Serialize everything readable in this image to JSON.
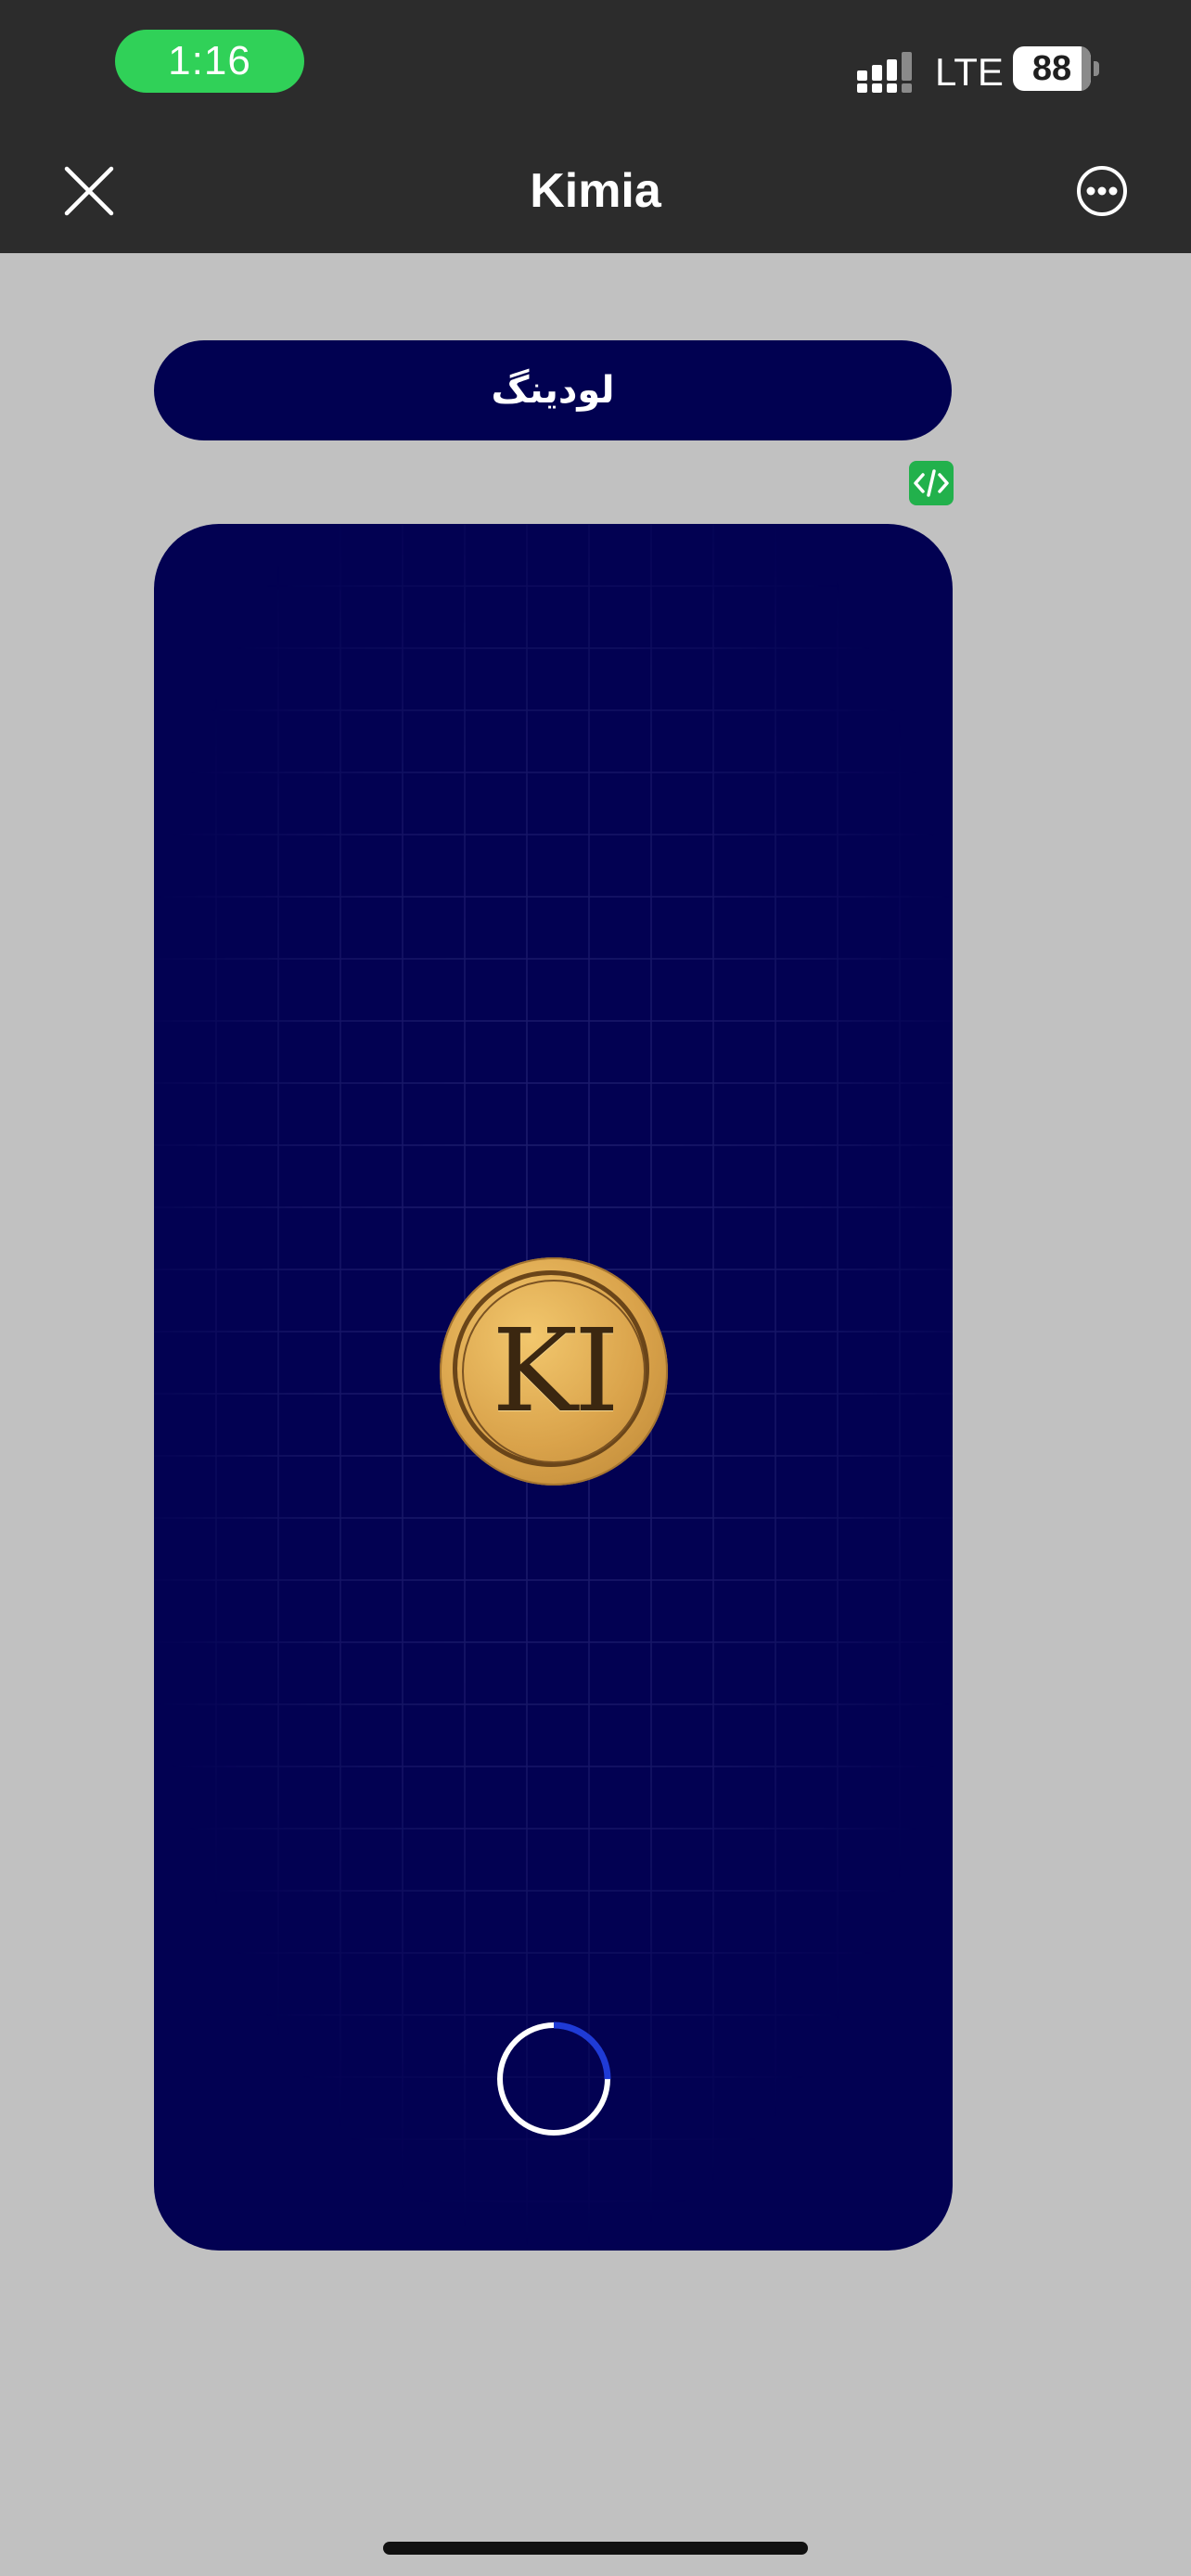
{
  "status_bar": {
    "time": "1:16",
    "network": "LTE",
    "battery_level": "88",
    "battery_fraction": 0.88
  },
  "nav": {
    "title": "Kimia",
    "close_icon": "close-icon",
    "more_icon": "more-options-icon"
  },
  "loading_button": {
    "label": "لودینگ"
  },
  "dev_badge": {
    "icon": "code-icon",
    "color": "#22b14c"
  },
  "game": {
    "coin_text": "KI",
    "spinner_progress": 0.25
  },
  "colors": {
    "accent": "#30d158",
    "card_background": "#020152",
    "spinner_accent": "#1f3bd6"
  }
}
